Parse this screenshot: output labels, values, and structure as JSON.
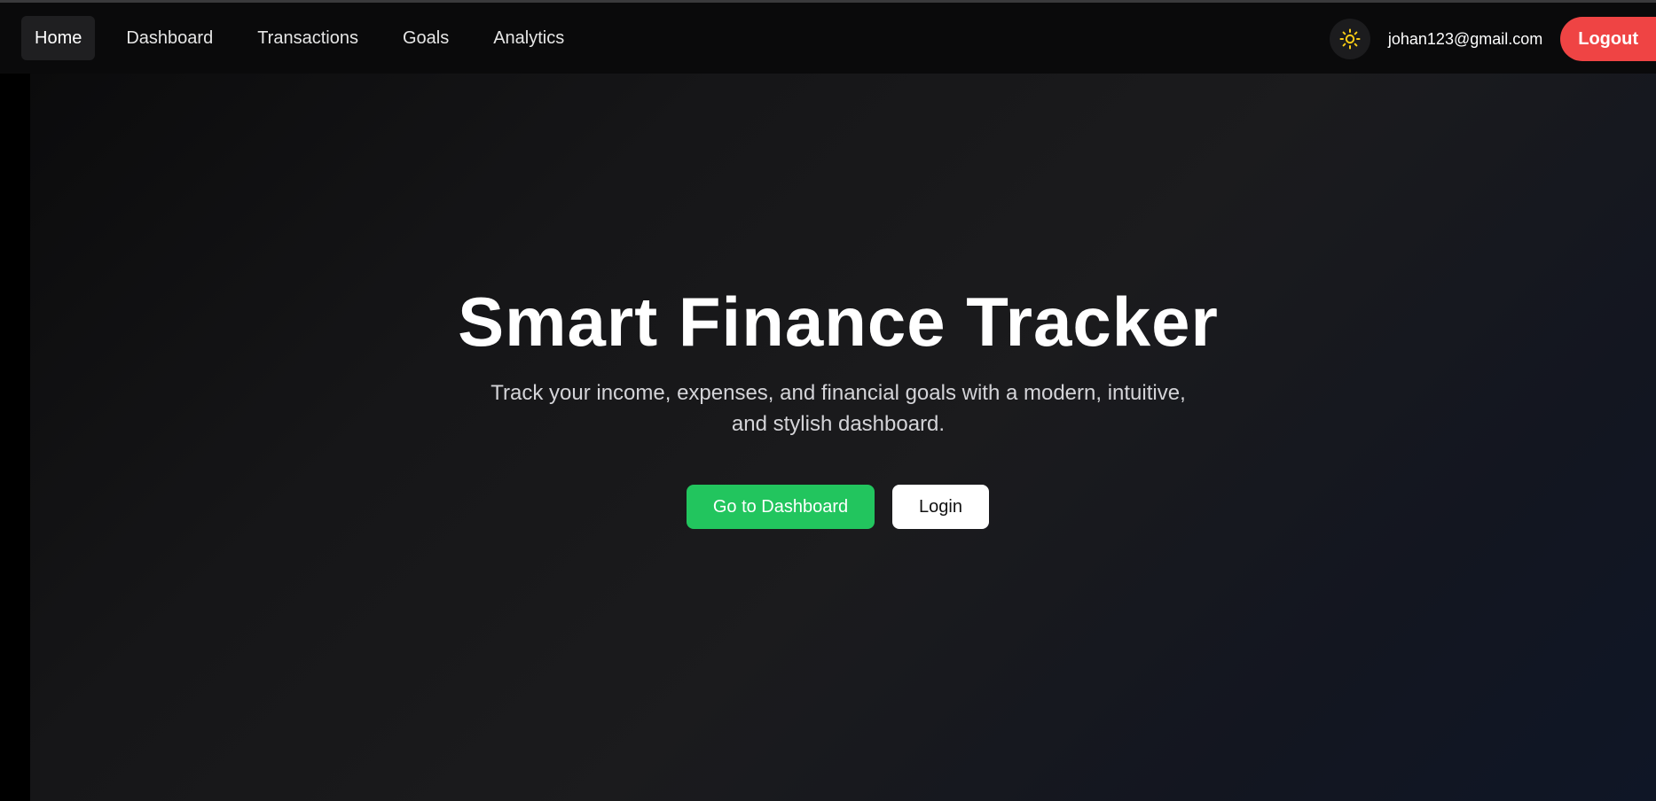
{
  "nav": {
    "links": [
      {
        "label": "Home",
        "active": true
      },
      {
        "label": "Dashboard",
        "active": false
      },
      {
        "label": "Transactions",
        "active": false
      },
      {
        "label": "Goals",
        "active": false
      },
      {
        "label": "Analytics",
        "active": false
      }
    ],
    "theme_icon": "sun-icon",
    "user_email": "johan123@gmail.com",
    "logout_label": "Logout"
  },
  "hero": {
    "title": "Smart Finance Tracker",
    "subtitle": "Track your income, expenses, and financial goals with a modern, intuitive, and stylish dashboard.",
    "primary_cta": "Go to Dashboard",
    "secondary_cta": "Login"
  },
  "colors": {
    "accent_green": "#22c55e",
    "logout_red": "#ef4444",
    "sun_yellow": "#facc15"
  }
}
